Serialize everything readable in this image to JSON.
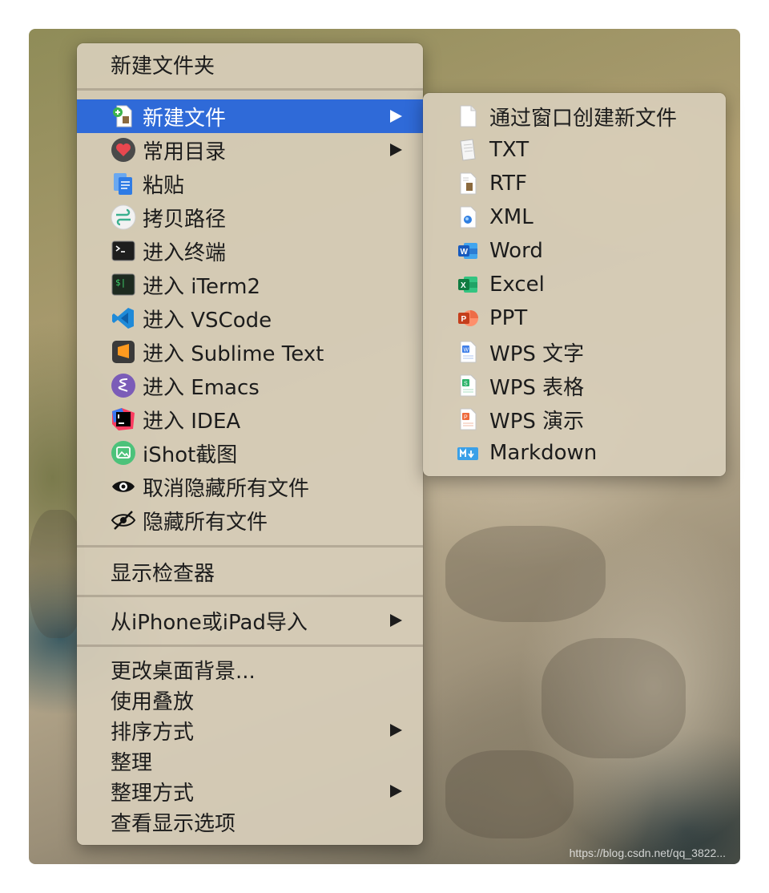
{
  "context_menu": {
    "items": [
      {
        "label": "新建文件夹"
      },
      {
        "label": "新建文件",
        "icon": "new-file-icon",
        "has_submenu": true,
        "highlighted": true
      },
      {
        "label": "常用目录",
        "icon": "heart-icon",
        "has_submenu": true
      },
      {
        "label": "粘贴",
        "icon": "paste-icon"
      },
      {
        "label": "拷贝路径",
        "icon": "copy-path-icon"
      },
      {
        "label": "进入终端",
        "icon": "terminal-icon"
      },
      {
        "label": "进入 iTerm2",
        "icon": "iterm2-icon"
      },
      {
        "label": "进入 VSCode",
        "icon": "vscode-icon"
      },
      {
        "label": "进入 Sublime Text",
        "icon": "sublime-text-icon"
      },
      {
        "label": "进入 Emacs",
        "icon": "emacs-icon"
      },
      {
        "label": "进入 IDEA",
        "icon": "idea-icon"
      },
      {
        "label": "iShot截图",
        "icon": "ishot-icon"
      },
      {
        "label": "取消隐藏所有文件",
        "icon": "eye-icon"
      },
      {
        "label": "隐藏所有文件",
        "icon": "eye-slash-icon"
      },
      {
        "label": "显示检查器"
      },
      {
        "label": "从iPhone或iPad导入",
        "has_submenu": true
      },
      {
        "label": "更改桌面背景..."
      },
      {
        "label": "使用叠放"
      },
      {
        "label": "排序方式",
        "has_submenu": true
      },
      {
        "label": "整理"
      },
      {
        "label": "整理方式",
        "has_submenu": true
      },
      {
        "label": "查看显示选项"
      }
    ]
  },
  "submenu": {
    "items": [
      {
        "label": "通过窗口创建新文件",
        "icon": "blank-file-icon"
      },
      {
        "label": "TXT",
        "icon": "txt-file-icon"
      },
      {
        "label": "RTF",
        "icon": "rtf-file-icon"
      },
      {
        "label": "XML",
        "icon": "xml-file-icon"
      },
      {
        "label": "Word",
        "icon": "word-icon"
      },
      {
        "label": "Excel",
        "icon": "excel-icon"
      },
      {
        "label": "PPT",
        "icon": "powerpoint-icon"
      },
      {
        "label": "WPS 文字",
        "icon": "wps-writer-icon"
      },
      {
        "label": "WPS 表格",
        "icon": "wps-spreadsheet-icon"
      },
      {
        "label": "WPS 演示",
        "icon": "wps-presentation-icon"
      },
      {
        "label": "Markdown",
        "icon": "markdown-icon"
      }
    ]
  },
  "watermark": "https://blog.csdn.net/qq_3822..."
}
